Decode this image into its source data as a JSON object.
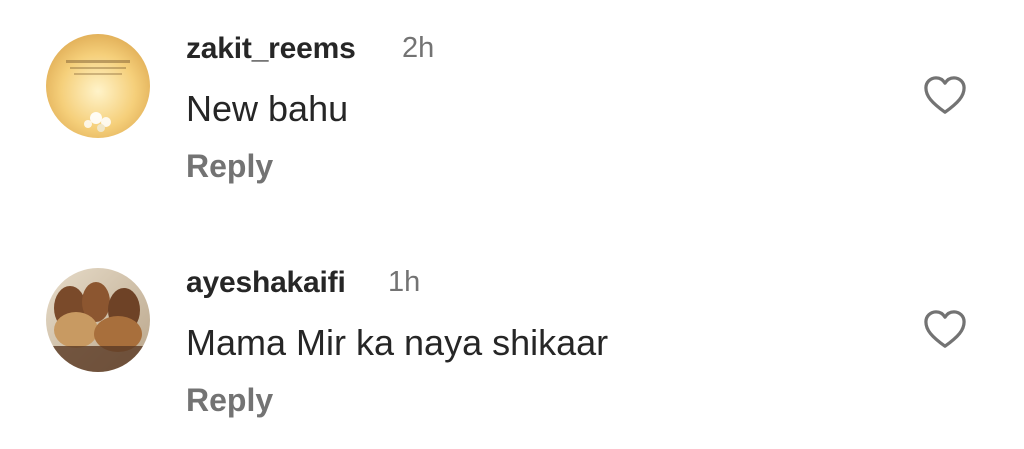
{
  "comments": [
    {
      "username": "zakit_reems",
      "time": "2h",
      "text": "New bahu",
      "reply_label": "Reply",
      "avatar_icon": "profile-avatar",
      "like_icon": "heart-outline-icon"
    },
    {
      "username": "ayeshakaifi",
      "time": "1h",
      "text": "Mama Mir ka naya shikaar",
      "reply_label": "Reply",
      "avatar_icon": "profile-avatar",
      "like_icon": "heart-outline-icon"
    }
  ],
  "colors": {
    "primary_text": "#262626",
    "secondary_text": "#737373",
    "background": "#ffffff"
  }
}
